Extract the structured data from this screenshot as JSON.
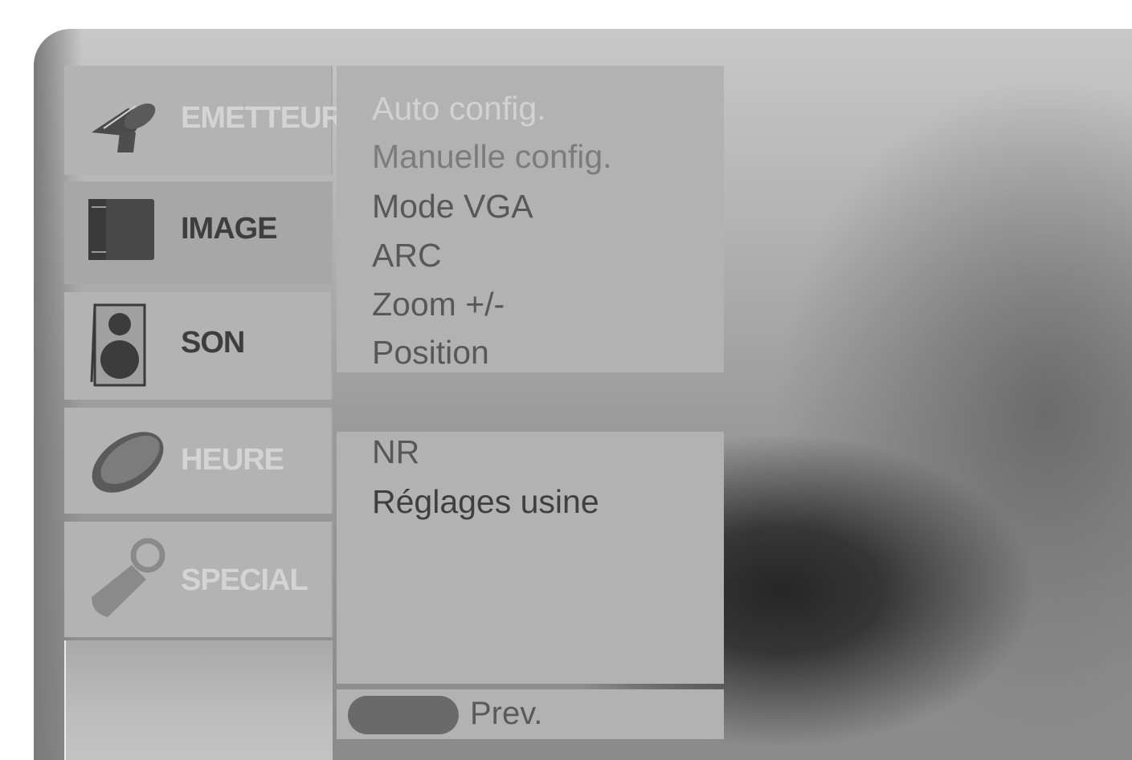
{
  "tabs": [
    {
      "label": "EMETTEUR",
      "icon": "satellite-dish-icon",
      "active": false
    },
    {
      "label": "IMAGE",
      "icon": "picture-icon",
      "active": true
    },
    {
      "label": "SON",
      "icon": "speaker-icon",
      "active": false
    },
    {
      "label": "HEURE",
      "icon": "clock-icon",
      "active": false
    },
    {
      "label": "SPECIAL",
      "icon": "tool-icon",
      "active": false
    }
  ],
  "menu": {
    "items": [
      "Auto config.",
      "Manuelle config.",
      "Mode VGA",
      "ARC",
      "Zoom +/-",
      "Position"
    ],
    "items2": [
      "NR",
      "Réglages usine"
    ]
  },
  "footer": {
    "button_icon": "menu-button-icon",
    "prev_label": "Prev."
  },
  "colors": {
    "panel_bg": "#b2b2b2",
    "button_pill": "#6a6a6a"
  }
}
